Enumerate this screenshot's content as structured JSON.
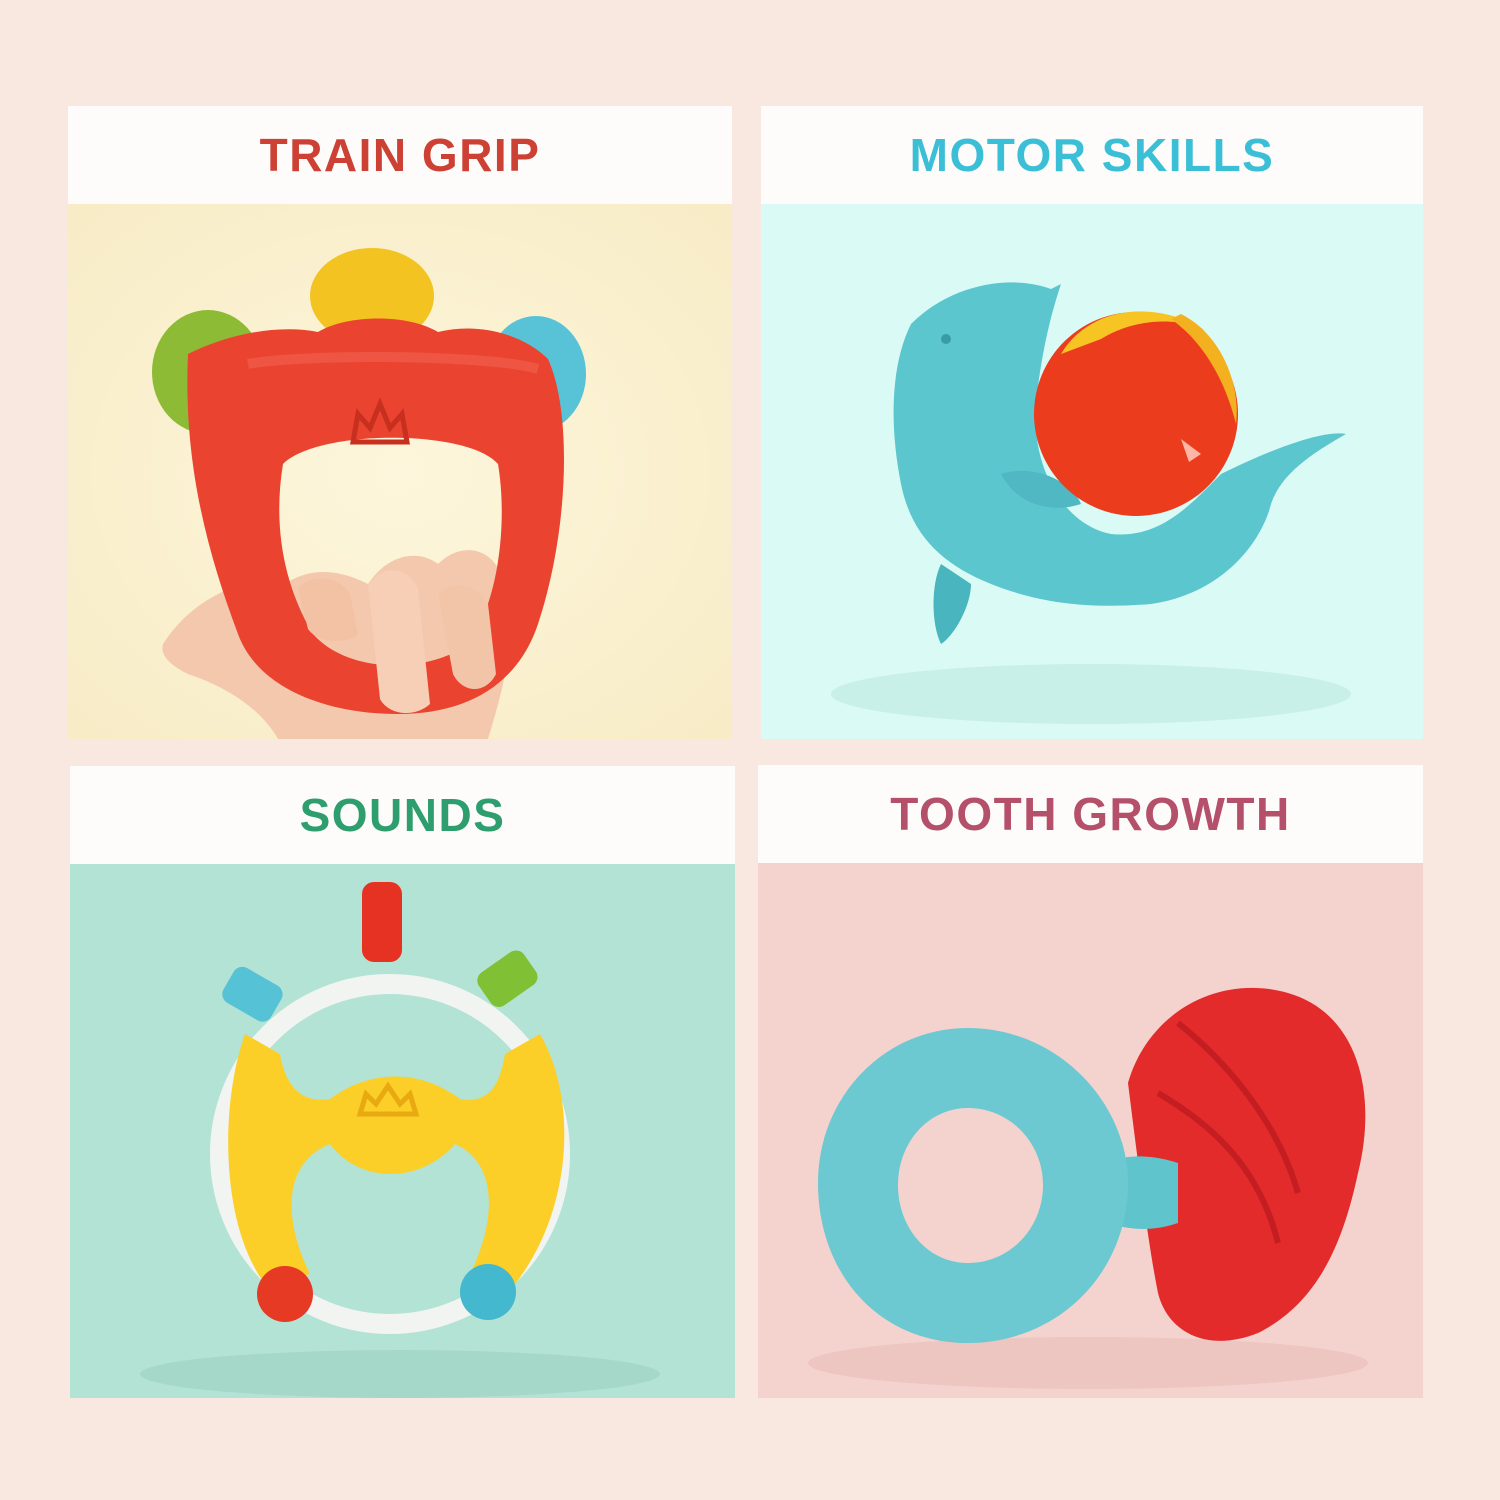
{
  "panels": [
    {
      "title": "TRAIN GRIP",
      "title_color": "#cd4134",
      "background": "#fbf1cf",
      "illustration": "tambourine-rattle-with-hand"
    },
    {
      "title": "MOTOR SKILLS",
      "title_color": "#3bbfd6",
      "background": "#dafaf5",
      "illustration": "dolphin-ball-rattle"
    },
    {
      "title": "SOUNDS",
      "title_color": "#2e9e6e",
      "background": "#b3e3d5",
      "illustration": "ring-rattle-with-beads"
    },
    {
      "title": "TOOTH GROWTH",
      "title_color": "#b5506a",
      "background": "#f4d3cf",
      "illustration": "shell-teether-ring"
    }
  ]
}
